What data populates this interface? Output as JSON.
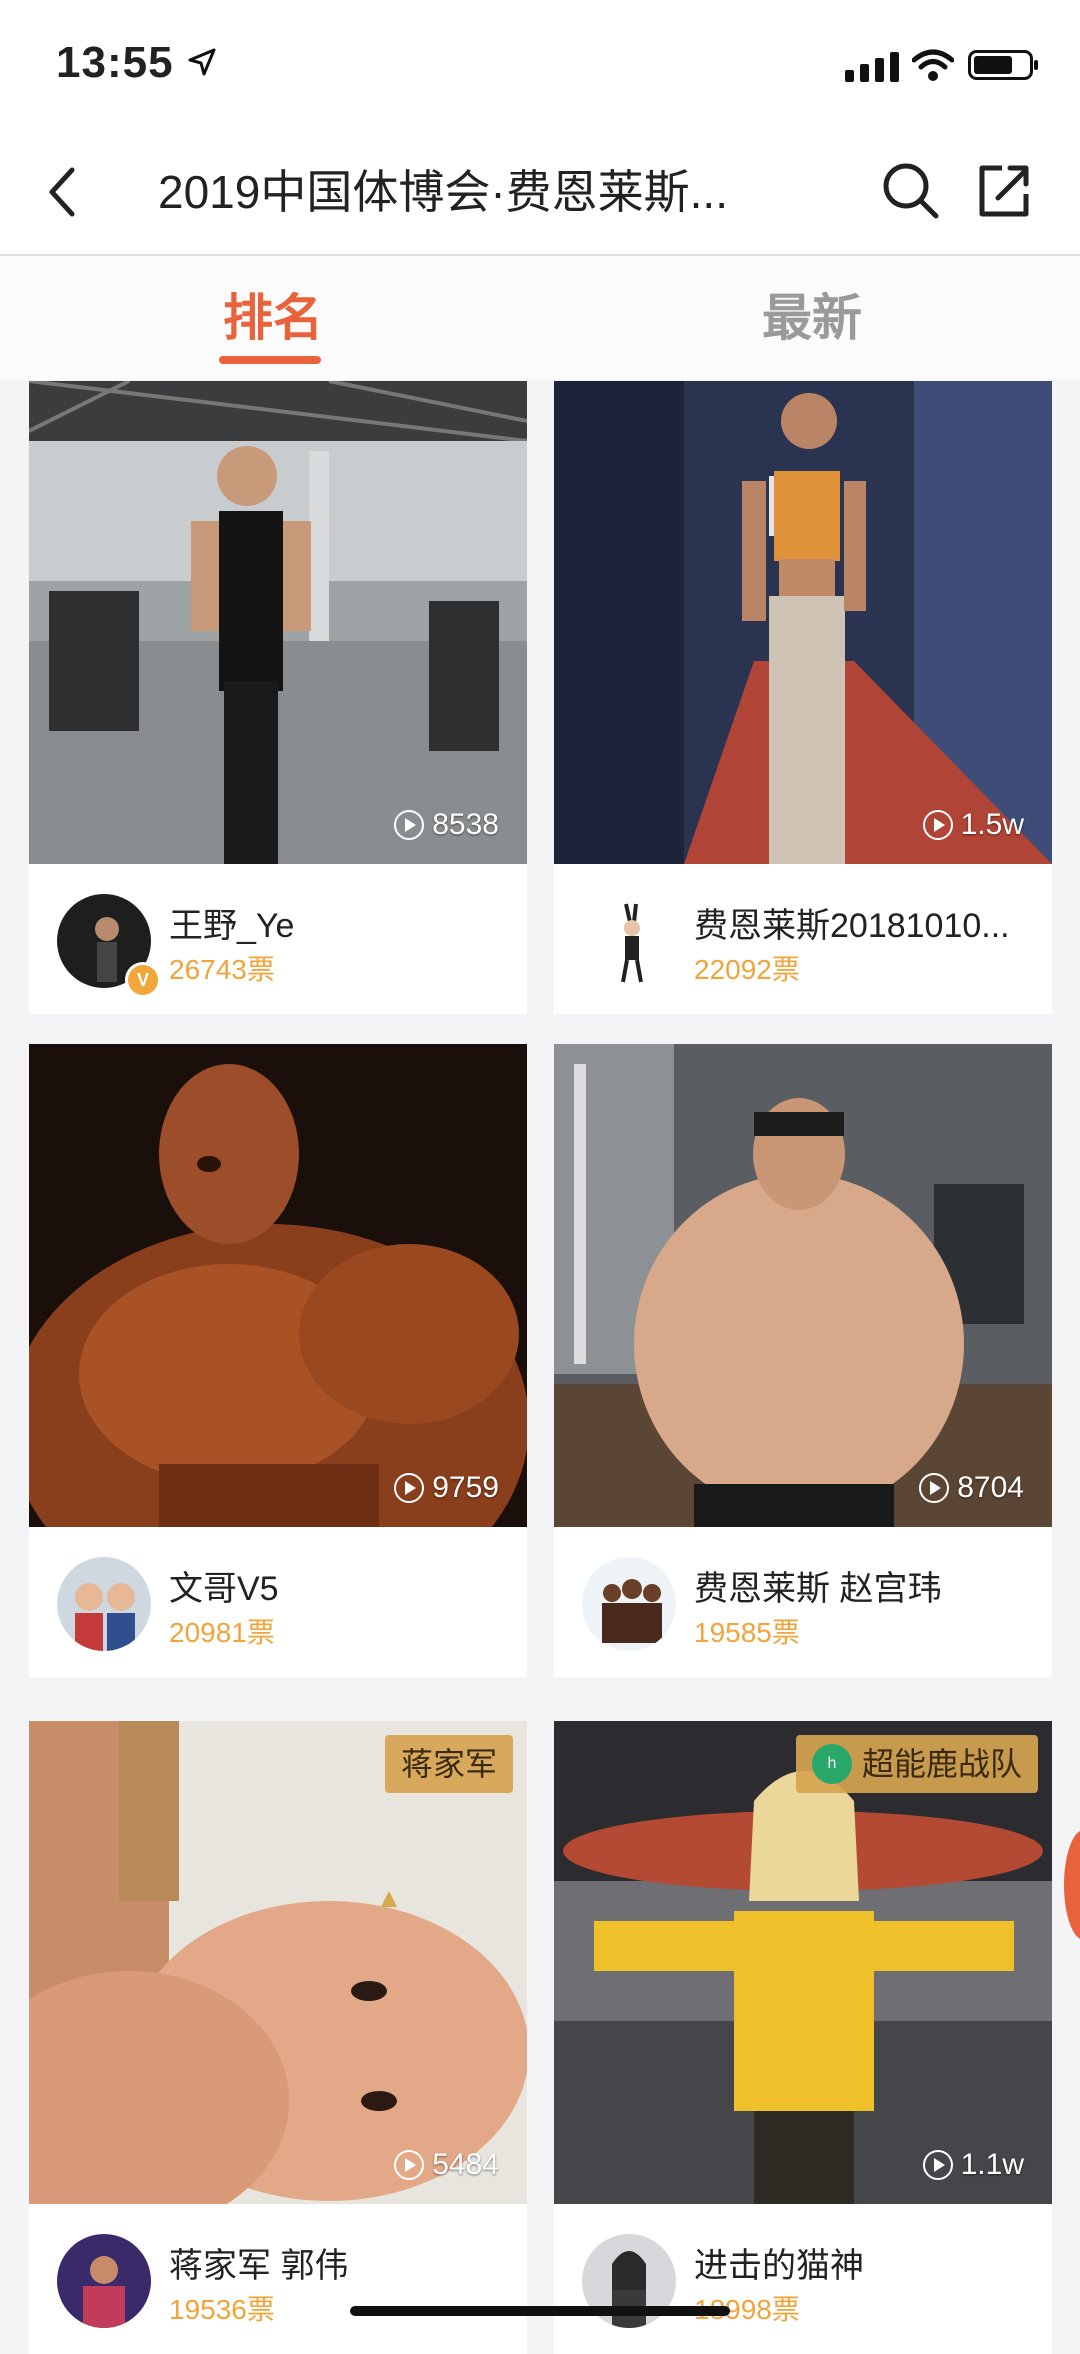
{
  "status_bar": {
    "time": "13:55"
  },
  "nav": {
    "title": "2019中国体博会·费恩莱斯..."
  },
  "tabs": [
    {
      "label": "排名"
    },
    {
      "label": "最新"
    }
  ],
  "cards": [
    {
      "views": "8538",
      "name": "王野_Ye",
      "votes": "26743票",
      "verified": true,
      "team": ""
    },
    {
      "views": "1.5w",
      "name": "费恩莱斯20181010...",
      "votes": "22092票",
      "team": ""
    },
    {
      "views": "9759",
      "name": "文哥V5",
      "votes": "20981票",
      "team": ""
    },
    {
      "views": "8704",
      "name": "费恩莱斯 赵宫玮",
      "votes": "19585票",
      "team": ""
    },
    {
      "views": "5484",
      "name": "蒋家军 郭伟",
      "votes": "19536票",
      "team": "蒋家军"
    },
    {
      "views": "1.1w",
      "name": "进击的猫神",
      "votes": "18998票",
      "team": "超能鹿战队"
    }
  ],
  "colors": {
    "accent": "#e8623c",
    "votes": "#f0a43a",
    "team_badge": "#d6a450"
  }
}
